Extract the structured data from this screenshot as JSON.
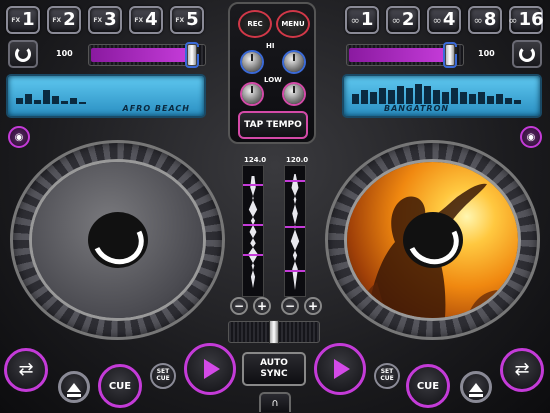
{
  "fx_buttons": [
    {
      "prefix": "FX",
      "num": "1"
    },
    {
      "prefix": "FX",
      "num": "2"
    },
    {
      "prefix": "FX",
      "num": "3"
    },
    {
      "prefix": "FX",
      "num": "4"
    },
    {
      "prefix": "FX",
      "num": "5"
    }
  ],
  "loop_buttons": [
    {
      "num": "1"
    },
    {
      "num": "2"
    },
    {
      "num": "4"
    },
    {
      "num": "8"
    },
    {
      "num": "16"
    }
  ],
  "center": {
    "rec_label": "REC",
    "menu_label": "MENU",
    "hi_label": "HI",
    "low_label": "LOW",
    "tap_tempo_label": "TAP TEMPO"
  },
  "deck_left": {
    "volume": "100",
    "track": "AFRO BEACH",
    "bpm": "124.0",
    "cue_label": "CUE",
    "set_cue_label": "SET\nCUE"
  },
  "deck_right": {
    "volume": "100",
    "track": "BANGATRON",
    "bpm": "120.0",
    "cue_label": "CUE",
    "set_cue_label": "SET\nCUE"
  },
  "mixer": {
    "minus": "−",
    "plus": "+",
    "auto_sync_label": "AUTO\nSYNC"
  },
  "colors": {
    "accent": "#c43bd8",
    "lcd": "#4bb4e0",
    "rec_border": "#d03848"
  }
}
